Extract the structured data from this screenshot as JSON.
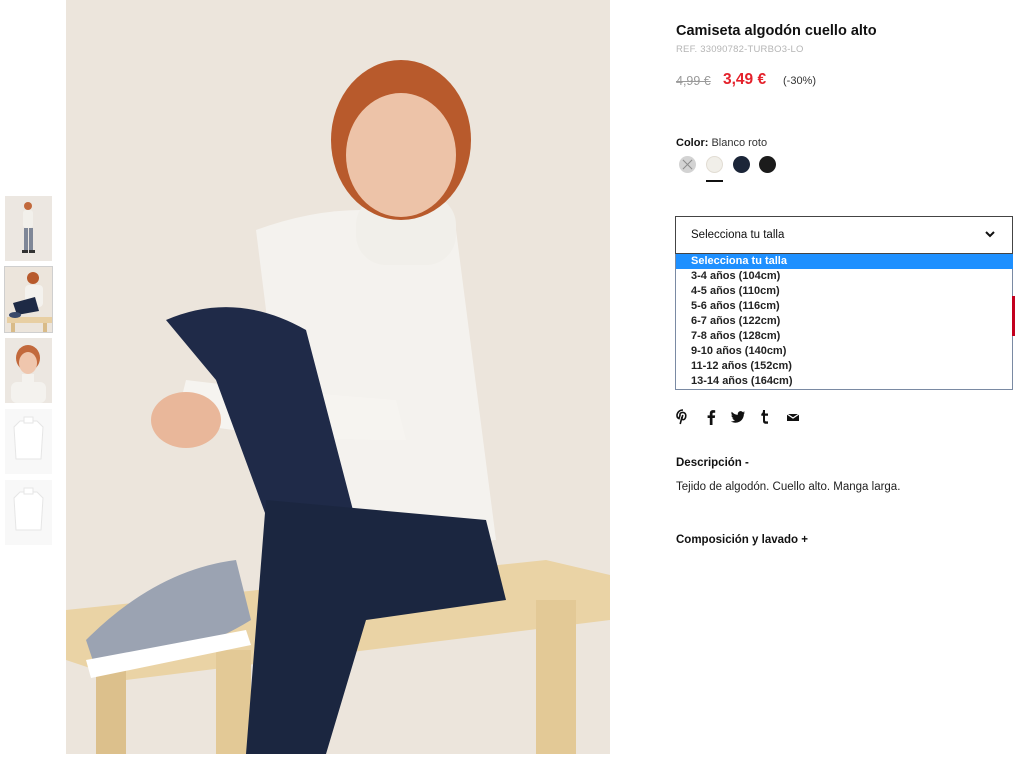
{
  "product": {
    "title": "Camiseta algodón cuello alto",
    "ref": "REF. 33090782-TURBO3-LO",
    "old_price": "4,99 €",
    "new_price": "3,49 €",
    "discount": "(-30%)"
  },
  "color": {
    "label": "Color:",
    "selected": "Blanco roto",
    "swatches": [
      {
        "name": "unavailable",
        "hex": "#d3d3d3"
      },
      {
        "name": "Blanco roto",
        "hex": "#f1efe9"
      },
      {
        "name": "navy",
        "hex": "#1b2538"
      },
      {
        "name": "black",
        "hex": "#1b1b1b"
      }
    ]
  },
  "size_select": {
    "placeholder": "Selecciona tu talla",
    "options": [
      "Selecciona tu talla",
      "3-4 años (104cm)",
      "4-5 años (110cm)",
      "5-6 años (116cm)",
      "6-7 años (122cm)",
      "7-8 años (128cm)",
      "9-10 años (140cm)",
      "11-12 años (152cm)",
      "13-14 años (164cm)"
    ]
  },
  "social": [
    "pinterest-icon",
    "facebook-icon",
    "twitter-icon",
    "tumblr-icon",
    "email-icon"
  ],
  "description": {
    "title": "Descripción -",
    "text": "Tejido de algodón. Cuello alto. Manga larga."
  },
  "composition": {
    "title": "Composición y lavado +"
  },
  "colors": {
    "sale_red": "#e4212b",
    "selected_option": "#1e90ff"
  }
}
